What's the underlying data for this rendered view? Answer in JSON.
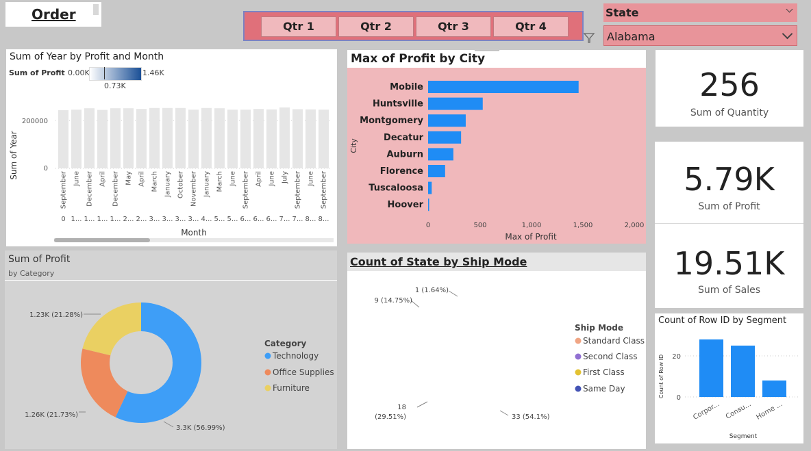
{
  "title": "Order",
  "quarters": [
    "Qtr 1",
    "Qtr 2",
    "Qtr 3",
    "Qtr 4"
  ],
  "state_slicer": {
    "label": "State",
    "value": "Alabama"
  },
  "cards": {
    "quantity": {
      "value": "256",
      "label": "Sum of Quantity"
    },
    "profit": {
      "value": "5.79K",
      "label": "Sum of Profit"
    },
    "sales": {
      "value": "19.51K",
      "label": "Sum of Sales"
    }
  },
  "colors": {
    "accent": "#1f8cf5",
    "pink_panel": "#f0b8bb",
    "qtr_bar": "#e0707a"
  },
  "chart_data": [
    {
      "id": "year_by_month",
      "type": "bar",
      "title": "Sum of Year by Profit and Month",
      "legend": {
        "label": "Sum of Profit",
        "min": "0.00K",
        "mid": "0.73K",
        "max": "1.46K"
      },
      "xlabel": "Month",
      "ylabel": "Sum of Year",
      "yticks": [
        "200000",
        "0"
      ],
      "ylim": [
        0,
        300000
      ],
      "categories": [
        "September",
        "June",
        "December",
        "April",
        "December",
        "May",
        "April",
        "March",
        "January",
        "October",
        "November",
        "January",
        "March",
        "June",
        "September",
        "April",
        "June",
        "July",
        "September",
        "June",
        "September"
      ],
      "sublabels": [
        "0",
        "1...",
        "1...",
        "1...",
        "1...",
        "2...",
        "2...",
        "3...",
        "3...",
        "3...",
        "3...",
        "4...",
        "5...",
        "5...",
        "6...",
        "6...",
        "6...",
        "7...",
        "7...",
        "8...",
        "8..."
      ],
      "values": [
        243000,
        245000,
        251000,
        244000,
        251000,
        251000,
        248000,
        252000,
        252000,
        252000,
        245000,
        252000,
        251000,
        245000,
        245000,
        248000,
        246000,
        254000,
        247000,
        246000,
        245000
      ]
    },
    {
      "id": "profit_by_city",
      "type": "bar",
      "orientation": "horizontal",
      "title": "Max of Profit by City",
      "xlabel": "Max of Profit",
      "ylabel": "City",
      "xticks": [
        "0",
        "500",
        "1,000",
        "1,500",
        "2,000"
      ],
      "xlim": [
        0,
        2000
      ],
      "categories": [
        "Mobile",
        "Huntsville",
        "Montgomery",
        "Decatur",
        "Auburn",
        "Florence",
        "Tuscaloosa",
        "Hoover"
      ],
      "values": [
        1460,
        530,
        365,
        320,
        245,
        165,
        35,
        8
      ]
    },
    {
      "id": "profit_by_category",
      "type": "pie",
      "title": "Sum of Profit",
      "subtitle": "by Category",
      "legend_title": "Category",
      "donut": true,
      "series": [
        {
          "name": "Technology",
          "value": 3300,
          "label": "3.3K (56.99%)",
          "color": "#3e9ef7"
        },
        {
          "name": "Office Supplies",
          "value": 1260,
          "label": "1.26K (21.73%)",
          "color": "#ee8a5c"
        },
        {
          "name": "Furniture",
          "value": 1230,
          "label": "1.23K (21.28%)",
          "color": "#ead062"
        }
      ]
    },
    {
      "id": "state_by_shipmode",
      "type": "pie",
      "title": "Count of State by Ship Mode",
      "legend_title": "Ship Mode",
      "series": [
        {
          "name": "Standard Class",
          "value": 33,
          "label": "33 (54.1%)",
          "color": "#f0a584"
        },
        {
          "name": "Second Class",
          "value": 18,
          "label": "18 (29.51%)",
          "color": "#9170d2"
        },
        {
          "name": "First Class",
          "value": 9,
          "label": "9 (14.75%)",
          "color": "#e3c232"
        },
        {
          "name": "Same Day",
          "value": 1,
          "label": "1 (1.64%)",
          "color": "#4453b5"
        }
      ]
    },
    {
      "id": "rows_by_segment",
      "type": "bar",
      "title": "Count of Row ID by Segment",
      "xlabel": "Segment",
      "ylabel": "Count of Row ID",
      "yticks": [
        "20",
        "0"
      ],
      "ylim": [
        0,
        30
      ],
      "categories": [
        "Corpor...",
        "Consu...",
        "Home ..."
      ],
      "values": [
        28,
        25,
        8
      ]
    }
  ]
}
